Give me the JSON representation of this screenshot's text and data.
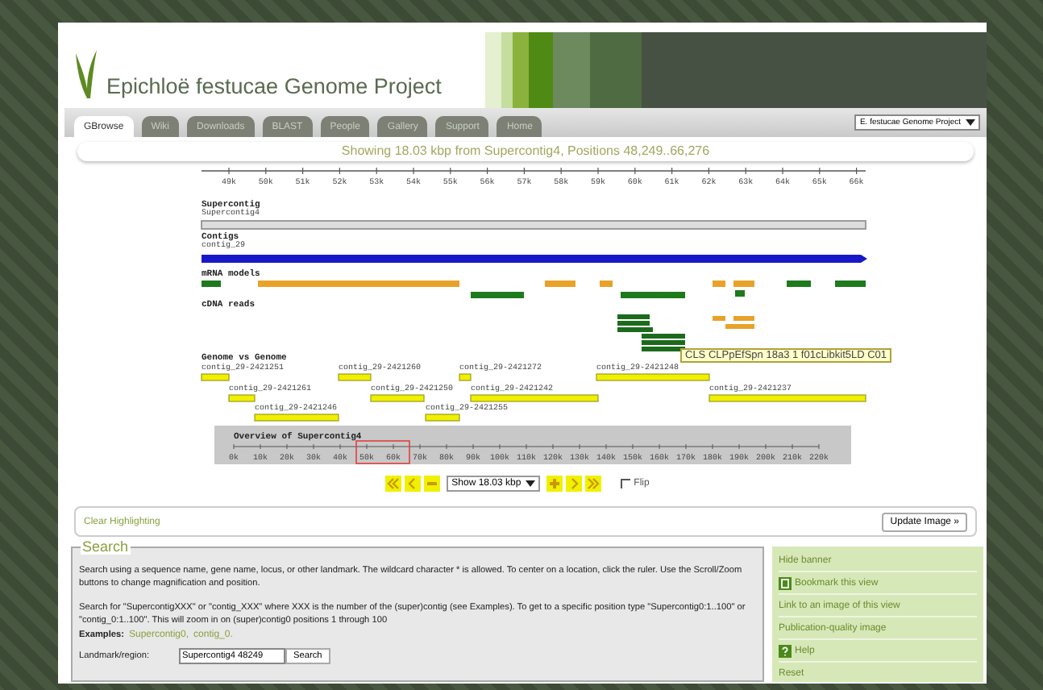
{
  "header": {
    "title": "Epichloë festucae Genome Project"
  },
  "tabs": [
    {
      "label": "GBrowse",
      "selected": true
    },
    {
      "label": "Wiki",
      "selected": false
    },
    {
      "label": "Downloads",
      "selected": false
    },
    {
      "label": "BLAST",
      "selected": false
    },
    {
      "label": "People",
      "selected": false
    },
    {
      "label": "Gallery",
      "selected": false
    },
    {
      "label": "Support",
      "selected": false
    },
    {
      "label": "Home",
      "selected": false
    }
  ],
  "project_select": {
    "value": "E. festucae Genome Project"
  },
  "showing": "Showing 18.03 kbp from Supercontig4, Positions 48,249..66,276",
  "ruler": {
    "ticks": [
      "49k",
      "50k",
      "51k",
      "52k",
      "53k",
      "54k",
      "55k",
      "56k",
      "57k",
      "58k",
      "59k",
      "60k",
      "61k",
      "62k",
      "63k",
      "64k",
      "65k",
      "66k"
    ]
  },
  "tracks": [
    {
      "kind": "supercontig",
      "title": "Supercontig",
      "label": "Supercontig4"
    },
    {
      "kind": "contig",
      "title": "Contigs",
      "label": "contig_29"
    },
    {
      "kind": "mrna",
      "title": "mRNA models"
    },
    {
      "kind": "cdna",
      "title": "cDNA reads"
    },
    {
      "kind": "genome",
      "title": "Genome vs Genome",
      "features": [
        {
          "label": "contig_29-2421251"
        },
        {
          "label": "contig_29-2421260"
        },
        {
          "label": "contig_29-2421272"
        },
        {
          "label": "contig_29-2421248"
        },
        {
          "label": "contig_29-2421261"
        },
        {
          "label": "contig_29-2421250"
        },
        {
          "label": "contig_29-2421242"
        },
        {
          "label": "contig_29-2421237"
        },
        {
          "label": "contig_29-2421246"
        },
        {
          "label": "contig_29-2421255"
        }
      ]
    }
  ],
  "tooltip": "CLS CLPpEfSpn 18a3 1 f01cLibkit5LD C01",
  "overview": {
    "title": "Overview of Supercontig4",
    "ticks": [
      "0k",
      "10k",
      "20k",
      "30k",
      "40k",
      "50k",
      "60k",
      "70k",
      "80k",
      "90k",
      "100k",
      "110k",
      "120k",
      "130k",
      "140k",
      "150k",
      "160k",
      "170k",
      "180k",
      "190k",
      "200k",
      "210k",
      "220k"
    ]
  },
  "nav": {
    "zoom_select": "Show 18.03 kbp",
    "flip": {
      "label": "Flip",
      "checked": false
    }
  },
  "clear_highlighting": "Clear Highlighting",
  "update_button": "Update Image »",
  "search": {
    "legend": "Search",
    "paragraphs": [
      "Search using a sequence name, gene name, locus, or other landmark. The wildcard character * is allowed. To center on a location, click the ruler. Use the Scroll/Zoom buttons to change magnification and position.",
      "Search for \"SupercontigXXX\" or \"contig_XXX\" where XXX is the number of the (super)contig (see Examples). To get to a specific position type \"Supercontig0:1..100\" or \"contig_0:1..100\". This will zoom in on (super)contig0 positions 1 through 100"
    ],
    "examples_label": "Examples:",
    "examples": [
      "Supercontig0,",
      "contig_0."
    ],
    "landmark_label": "Landmark/region:",
    "landmark_value": "Supercontig4 48249",
    "button": "Search"
  },
  "sidebar": [
    {
      "kind": "plain",
      "label": "Hide banner"
    },
    {
      "kind": "bookmark",
      "label": "Bookmark this view"
    },
    {
      "kind": "plain",
      "label": "Link to an image of this view"
    },
    {
      "kind": "plain",
      "label": "Publication-quality image"
    },
    {
      "kind": "help",
      "label": "Help"
    },
    {
      "kind": "plain",
      "label": "Reset"
    }
  ]
}
